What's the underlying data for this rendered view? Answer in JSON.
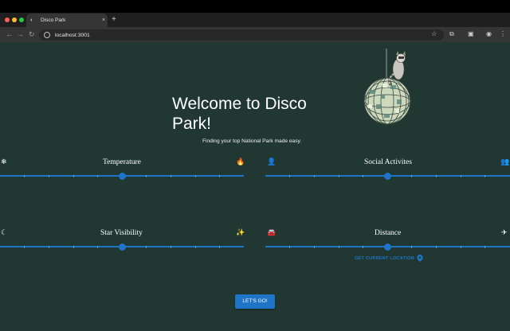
{
  "browser": {
    "tab_title": "Disco Park",
    "new_tab_label": "+",
    "close_label": "×",
    "url": "localhost:3001"
  },
  "hero": {
    "title": "Welcome to Disco Park!",
    "subtitle": "Finding your top National Park made easy."
  },
  "sliders": [
    {
      "label": "Temperature",
      "left_icon": "snowflake-icon",
      "right_icon": "fire-icon",
      "value": 0.5
    },
    {
      "label": "Social Activites",
      "left_icon": "person-icon",
      "right_icon": "group-icon",
      "value": 0.5
    },
    {
      "label": "Star Visibility",
      "left_icon": "moon-icon",
      "right_icon": "sparkle-icon",
      "value": 0.5
    },
    {
      "label": "Distance",
      "left_icon": "car-icon",
      "right_icon": "airplane-icon",
      "value": 0.5
    }
  ],
  "location_button": "GET CURRENT LOCATION",
  "submit_button": "LET'S GO!",
  "colors": {
    "background": "#203831",
    "accent": "#1e74c6"
  }
}
